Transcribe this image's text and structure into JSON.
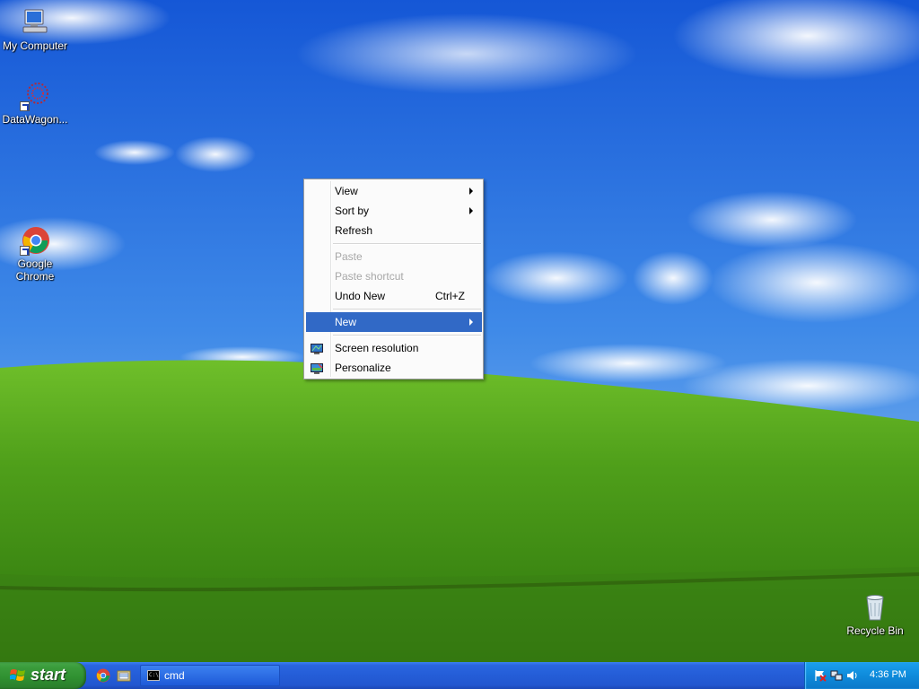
{
  "desktop": {
    "icons": [
      {
        "label": "My Computer",
        "icon": "my-computer-icon"
      },
      {
        "label": "DataWagon...",
        "icon": "datawagon-icon"
      },
      {
        "label": "Google\nChrome",
        "icon": "chrome-icon"
      },
      {
        "label": "Recycle Bin",
        "icon": "recycle-bin-icon"
      }
    ]
  },
  "context_menu": {
    "items": [
      {
        "label": "View",
        "submenu": true
      },
      {
        "label": "Sort by",
        "submenu": true
      },
      {
        "label": "Refresh"
      },
      {
        "label": "Paste",
        "disabled": true
      },
      {
        "label": "Paste shortcut",
        "disabled": true
      },
      {
        "label": "Undo New",
        "shortcut": "Ctrl+Z"
      },
      {
        "label": "New",
        "submenu": true,
        "highlighted": true
      },
      {
        "label": "Screen resolution",
        "icon": "screen-resolution-icon"
      },
      {
        "label": "Personalize",
        "icon": "personalize-icon"
      }
    ],
    "highlight_color": "#3169c6"
  },
  "taskbar": {
    "start_label": "start",
    "quick_launch": [
      "chrome-icon",
      "folder-icon"
    ],
    "tasks": [
      {
        "label": "cmd",
        "icon": "cmd-icon"
      }
    ],
    "tray": {
      "icons": [
        "action-center-flag-icon",
        "network-icon",
        "volume-icon"
      ],
      "clock": "4:36 PM"
    }
  }
}
